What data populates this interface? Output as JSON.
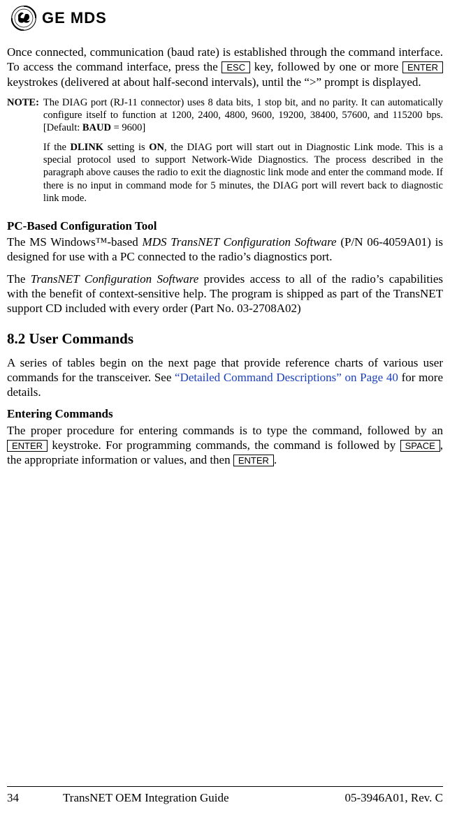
{
  "brand": {
    "name": "GE MDS"
  },
  "para1_a": "Once connected, communication (baud rate) is established through the command interface. To access the command interface, press the ",
  "key_esc": "ESC",
  "para1_b": " key, followed by one or more ",
  "key_enter": "ENTER",
  "para1_c": " keystrokes (delivered at about half-second intervals), until the “>” prompt is displayed.",
  "note_label": "NOTE:",
  "note1_a": "The DIAG port (RJ-11 connector) uses 8 data bits, 1 stop bit, and no parity. It can automatically configure itself to function at 1200, 2400, 4800, 9600, 19200, 38400, 57600, and 115200 bps. [Default: ",
  "note1_bold": "BAUD",
  "note1_b": " = 9600]",
  "note2_a": "If the ",
  "note2_bold1": "DLINK",
  "note2_b": " setting is ",
  "note2_bold2": "ON",
  "note2_c": ", the DIAG port will start out in Diagnostic Link mode. This is a special protocol used to support Network-Wide Diagnostics. The process described in the paragraph above causes the radio to exit the diagnostic link mode and enter the command mode. If there is no input in command mode for 5 minutes, the DIAG port will revert back to diagnostic link mode.",
  "subheading1": "PC-Based Configuration Tool",
  "para2_a": "The MS Windows™-based ",
  "para2_italic": "MDS TransNET Configuration Software",
  "para2_b": " (P/N 06-4059A01) is designed for use with a PC connected to the radio’s diagnostics port.",
  "para3_a": "The ",
  "para3_italic": "TransNET Configuration Software",
  "para3_b": " provides access to all of the radio’s capabilities with the benefit of context-sensitive help. The program is shipped as part of the TransNET support CD included with every order (Part No. 03-2708A02)",
  "section_heading": "8.2   User Commands",
  "para4_a": "A series of tables begin on the next page that provide reference charts of various user commands for the transceiver. See ",
  "para4_link": "“Detailed Command Descriptions” on Page 40",
  "para4_b": " for more details.",
  "subheading2": "Entering Commands",
  "para5_a": "The proper procedure for entering commands is to type the command, followed by an ",
  "para5_b": " keystroke. For programming commands, the command is followed by ",
  "key_space": "SPACE",
  "para5_c": ", the appropriate information or values, and then ",
  "para5_d": ".",
  "footer": {
    "page": "34",
    "title": "TransNET OEM Integration Guide",
    "rev": "05-3946A01, Rev. C"
  }
}
